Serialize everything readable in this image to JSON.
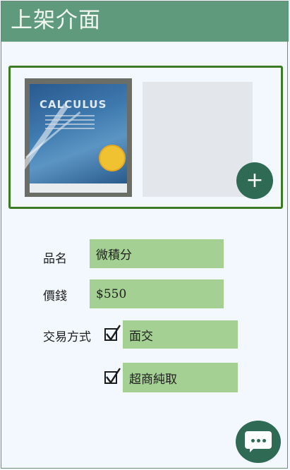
{
  "header": {
    "title": "上架介面"
  },
  "photos": {
    "book": {
      "cover_title": "CALCULUS",
      "image_label": "book-photo"
    },
    "add_label": "+"
  },
  "form": {
    "name": {
      "label": "品名",
      "value": "微積分"
    },
    "price": {
      "label": "價錢",
      "value": "$550"
    },
    "trade": {
      "label": "交易方式",
      "options": [
        {
          "label": "面交",
          "checked": true
        },
        {
          "label": "超商純取",
          "checked": true
        }
      ]
    }
  },
  "colors": {
    "header": "#5f9a7c",
    "accent": "#2f6a55",
    "field": "#a4d193",
    "panel_border": "#3c7a23"
  },
  "icons": {
    "add": "plus-icon",
    "chat": "chat-bubble-icon",
    "check": "checkmark-icon"
  }
}
